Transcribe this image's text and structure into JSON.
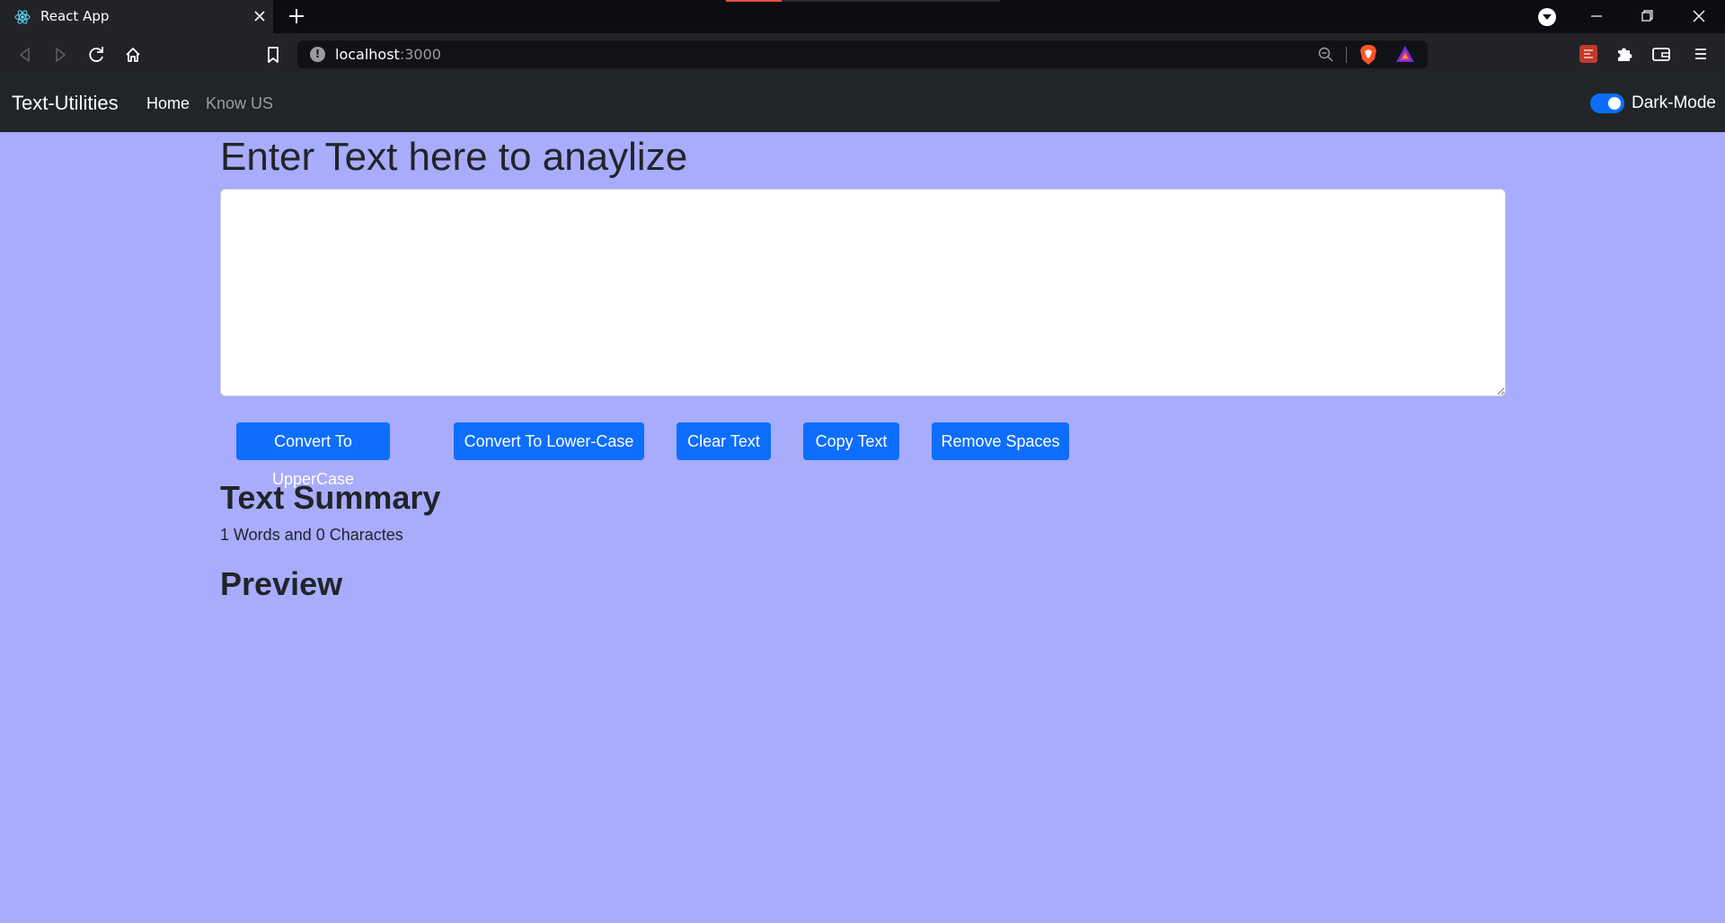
{
  "browser": {
    "tab_title": "React App",
    "url_host": "localhost",
    "url_port": ":3000",
    "icons": [
      "react-favicon",
      "close-icon",
      "plus-icon",
      "brave-menu-icon",
      "minimize-icon",
      "restore-icon",
      "close-window-icon",
      "back-icon",
      "forward-icon",
      "reload-icon",
      "home-icon",
      "bookmark-icon",
      "info-icon",
      "zoom-out-icon",
      "brave-shields-icon",
      "brave-rewards-icon",
      "extension-icon",
      "puzzle-icon",
      "wallet-icon",
      "menu-icon"
    ]
  },
  "navbar": {
    "brand": "Text-Utilities",
    "links": [
      {
        "label": "Home",
        "active": true
      },
      {
        "label": "Know US",
        "active": false
      }
    ],
    "dark_mode_label": "Dark-Mode",
    "dark_mode_enabled": true
  },
  "main": {
    "heading": "Enter Text here to anaylize",
    "textarea_value": "",
    "buttons": [
      {
        "label": "Convert To UpperCase"
      },
      {
        "label": "Convert To Lower-Case"
      },
      {
        "label": "Clear Text"
      },
      {
        "label": "Copy Text"
      },
      {
        "label": "Remove Spaces"
      }
    ]
  },
  "summary": {
    "heading": "Text Summary",
    "text": "1 Words and 0 Charactes",
    "preview_heading": "Preview"
  },
  "colors": {
    "page_background": "#a8acfc",
    "navbar_background": "#212529",
    "button_primary": "#0d6efd",
    "text_dark": "#212529"
  }
}
